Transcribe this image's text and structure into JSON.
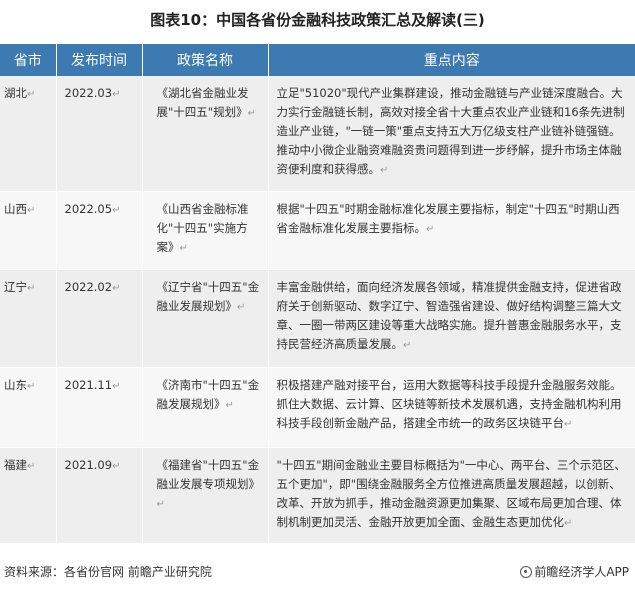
{
  "title": "图表10：中国各省份金融科技政策汇总及解读(三)",
  "table": {
    "headers": [
      "省市",
      "发布时间",
      "政策名称",
      "重点内容"
    ],
    "rows": [
      {
        "province": "湖北",
        "date": "2022.03",
        "policy": "《湖北省金融业发展\"十四五\"规划》",
        "content": "立足\"51020\"现代产业集群建设，推动金融链与产业链深度融合。大力实行金融链长制，高效对接全省十大重点农业产业链和16条先进制造业产业链，\"一链一策\"重点支持五大万亿级支柱产业链补链强链。推动中小微企业融资难融资贵问题得到进一步纾解，提升市场主体融资便利度和获得感。"
      },
      {
        "province": "山西",
        "date": "2022.05",
        "policy": "《山西省金融标准化\"十四五\"实施方案》",
        "content": "根据\"十四五\"时期金融标准化发展主要指标，制定\"十四五\"时期山西省金融标准化发展主要指标。"
      },
      {
        "province": "辽宁",
        "date": "2022.02",
        "policy": "《辽宁省\"十四五\"金融业发展规划》",
        "content": "丰富金融供给，面向经济发展各领域，精准提供金融支持，促进省政府关于创新驱动、数字辽宁、智造强省建设、做好结构调整三篇大文章、一圈一带两区建设等重大战略实施。提升普惠金融服务水平，支持民营经济高质量发展。"
      },
      {
        "province": "山东",
        "date": "2021.11",
        "policy": "《济南市\"十四五\"金融发展规划》",
        "content": "积极搭建产融对接平台，运用大数据等科技手段提升金融服务效能。抓住大数据、云计算、区块链等新技术发展机遇，支持金融机构利用科技手段创新金融产品，搭建全市统一的政务区块链平台"
      },
      {
        "province": "福建",
        "date": "2021.09",
        "policy": "《福建省\"十四五\"金融业发展专项规划》",
        "content": "\"十四五\"期间金融业主要目标概括为\"一中心、两平台、三个示范区、五个更加\"，即\"围绕金融服务全方位推进高质量发展超越，以创新、改革、开放为抓手，推动金融资源更加集聚、区域布局更加合理、体制机制更加灵活、金融开放更加全面、金融生态更加优化"
      }
    ]
  },
  "footer": {
    "source": "资料来源：各省份官网 前瞻产业研究院",
    "brand": "前瞻经济学人APP",
    "brand_icon": "brand-logo-icon"
  },
  "return_mark": "↵"
}
